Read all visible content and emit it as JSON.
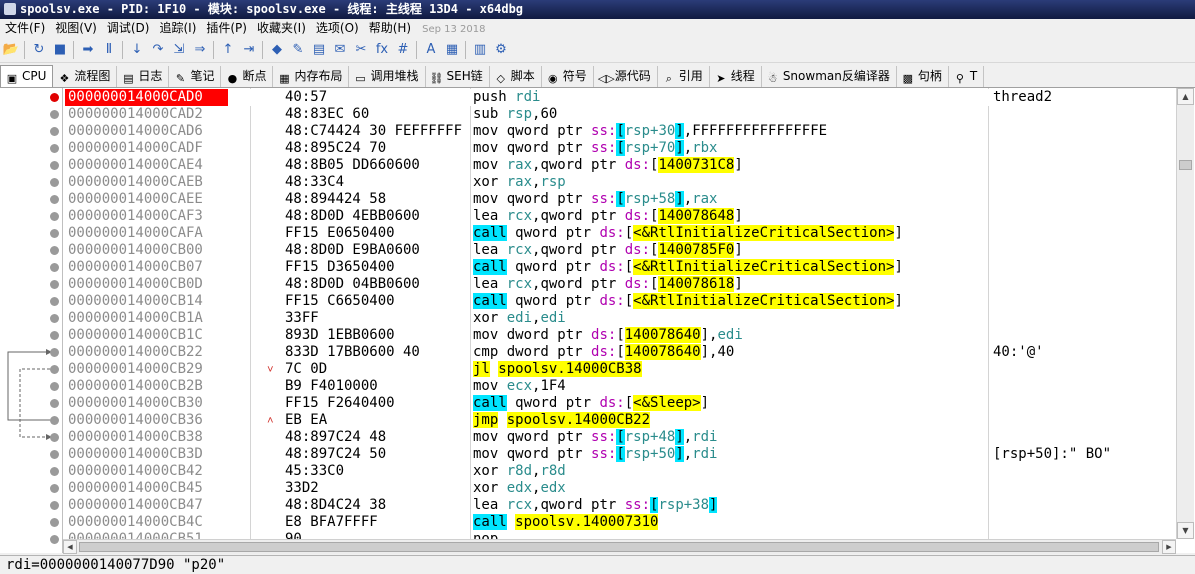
{
  "window": {
    "title": "spoolsv.exe - PID: 1F10 - 模块: spoolsv.exe - 线程: 主线程 13D4 - x64dbg"
  },
  "menu": {
    "items": [
      "文件(F)",
      "视图(V)",
      "调试(D)",
      "追踪(I)",
      "插件(P)",
      "收藏夹(I)",
      "选项(O)",
      "帮助(H)"
    ],
    "build_date": "Sep 13 2018"
  },
  "toolbar": {
    "icons": [
      "open-icon",
      "restart-icon",
      "stop-icon",
      "run-icon",
      "pause-icon",
      "step-into-icon",
      "step-over-icon",
      "trace-into-icon",
      "trace-over-icon",
      "execute-till-return-icon",
      "run-to-user-code-icon",
      "scylla-icon",
      "patch-icon",
      "comment-icon",
      "label-icon",
      "bookmark-icon",
      "function-icon",
      "hash-icon",
      "font-icon",
      "strings-icon",
      "calculator-icon",
      "settings-icon"
    ],
    "glyphs": [
      "📂",
      "↻",
      "■",
      "➡",
      "Ⅱ",
      "↓",
      "↷",
      "⇲",
      "⇒",
      "↑",
      "⇥",
      "◆",
      "✎",
      "▤",
      "✉",
      "✂",
      "fx",
      "#",
      "A",
      "▦",
      "▥",
      "⚙"
    ]
  },
  "tabs": [
    {
      "label": "CPU",
      "icon": "cpu-icon",
      "glyph": "▣",
      "active": true
    },
    {
      "label": "流程图",
      "icon": "graph-icon",
      "glyph": "❖"
    },
    {
      "label": "日志",
      "icon": "log-icon",
      "glyph": "▤"
    },
    {
      "label": "笔记",
      "icon": "notes-icon",
      "glyph": "✎"
    },
    {
      "label": "断点",
      "icon": "breakpoint-icon",
      "glyph": "●"
    },
    {
      "label": "内存布局",
      "icon": "memory-map-icon",
      "glyph": "▦"
    },
    {
      "label": "调用堆栈",
      "icon": "callstack-icon",
      "glyph": "▭"
    },
    {
      "label": "SEH链",
      "icon": "seh-icon",
      "glyph": "⛓"
    },
    {
      "label": "脚本",
      "icon": "script-icon",
      "glyph": "◇"
    },
    {
      "label": "符号",
      "icon": "symbols-icon",
      "glyph": "◉"
    },
    {
      "label": "源代码",
      "icon": "source-icon",
      "glyph": "◁▷"
    },
    {
      "label": "引用",
      "icon": "references-icon",
      "glyph": "⌕"
    },
    {
      "label": "线程",
      "icon": "threads-icon",
      "glyph": "➤"
    },
    {
      "label": "Snowman反编译器",
      "icon": "snowman-icon",
      "glyph": "☃"
    },
    {
      "label": "句柄",
      "icon": "handles-icon",
      "glyph": "▩"
    },
    {
      "label": "T",
      "icon": "trace-icon",
      "glyph": "⚲"
    }
  ],
  "disasm": {
    "rows": [
      {
        "addr": "000000014000CAD0",
        "bytes": "40:57",
        "asm": [
          [
            "m",
            "push "
          ],
          [
            "r",
            "rdi"
          ]
        ],
        "cmt": "thread2",
        "bp": true,
        "sel": true
      },
      {
        "addr": "000000014000CAD2",
        "bytes": "48:83EC 60",
        "asm": [
          [
            "m",
            "sub "
          ],
          [
            "r",
            "rsp"
          ],
          [
            "m",
            ",60"
          ]
        ]
      },
      {
        "addr": "000000014000CAD6",
        "bytes": "48:C74424 30 FEFFFFFF",
        "asm": [
          [
            "m",
            "mov qword ptr "
          ],
          [
            "s",
            "ss:"
          ],
          [
            "c",
            "["
          ],
          [
            "r",
            "rsp+30"
          ],
          [
            "c",
            "]"
          ],
          [
            "m",
            ",FFFFFFFFFFFFFFFE"
          ]
        ]
      },
      {
        "addr": "000000014000CADF",
        "bytes": "48:895C24 70",
        "asm": [
          [
            "m",
            "mov qword ptr "
          ],
          [
            "s",
            "ss:"
          ],
          [
            "c",
            "["
          ],
          [
            "r",
            "rsp+70"
          ],
          [
            "c",
            "]"
          ],
          [
            "m",
            ","
          ],
          [
            "r",
            "rbx"
          ]
        ]
      },
      {
        "addr": "000000014000CAE4",
        "bytes": "48:8B05 DD660600",
        "asm": [
          [
            "m",
            "mov "
          ],
          [
            "r",
            "rax"
          ],
          [
            "m",
            ",qword ptr "
          ],
          [
            "s",
            "ds:"
          ],
          [
            "m",
            "["
          ],
          [
            "h",
            "1400731C8"
          ],
          [
            "m",
            "]"
          ]
        ]
      },
      {
        "addr": "000000014000CAEB",
        "bytes": "48:33C4",
        "asm": [
          [
            "m",
            "xor "
          ],
          [
            "r",
            "rax"
          ],
          [
            "m",
            ","
          ],
          [
            "r",
            "rsp"
          ]
        ]
      },
      {
        "addr": "000000014000CAEE",
        "bytes": "48:894424 58",
        "asm": [
          [
            "m",
            "mov qword ptr "
          ],
          [
            "s",
            "ss:"
          ],
          [
            "c",
            "["
          ],
          [
            "r",
            "rsp+58"
          ],
          [
            "c",
            "]"
          ],
          [
            "m",
            ","
          ],
          [
            "r",
            "rax"
          ]
        ]
      },
      {
        "addr": "000000014000CAF3",
        "bytes": "48:8D0D 4EBB0600",
        "asm": [
          [
            "m",
            "lea "
          ],
          [
            "r",
            "rcx"
          ],
          [
            "m",
            ",qword ptr "
          ],
          [
            "s",
            "ds:"
          ],
          [
            "m",
            "["
          ],
          [
            "h",
            "140078648"
          ],
          [
            "m",
            "]"
          ]
        ]
      },
      {
        "addr": "000000014000CAFA",
        "bytes": "FF15 E0650400",
        "asm": [
          [
            "c",
            "call"
          ],
          [
            "m",
            " qword ptr "
          ],
          [
            "s",
            "ds:"
          ],
          [
            "m",
            "["
          ],
          [
            "h",
            "<&RtlInitializeCriticalSection>"
          ],
          [
            "m",
            "]"
          ]
        ]
      },
      {
        "addr": "000000014000CB00",
        "bytes": "48:8D0D E9BA0600",
        "asm": [
          [
            "m",
            "lea "
          ],
          [
            "r",
            "rcx"
          ],
          [
            "m",
            ",qword ptr "
          ],
          [
            "s",
            "ds:"
          ],
          [
            "m",
            "["
          ],
          [
            "h",
            "1400785F0"
          ],
          [
            "m",
            "]"
          ]
        ]
      },
      {
        "addr": "000000014000CB07",
        "bytes": "FF15 D3650400",
        "asm": [
          [
            "c",
            "call"
          ],
          [
            "m",
            " qword ptr "
          ],
          [
            "s",
            "ds:"
          ],
          [
            "m",
            "["
          ],
          [
            "h",
            "<&RtlInitializeCriticalSection>"
          ],
          [
            "m",
            "]"
          ]
        ]
      },
      {
        "addr": "000000014000CB0D",
        "bytes": "48:8D0D 04BB0600",
        "asm": [
          [
            "m",
            "lea "
          ],
          [
            "r",
            "rcx"
          ],
          [
            "m",
            ",qword ptr "
          ],
          [
            "s",
            "ds:"
          ],
          [
            "m",
            "["
          ],
          [
            "h",
            "140078618"
          ],
          [
            "m",
            "]"
          ]
        ]
      },
      {
        "addr": "000000014000CB14",
        "bytes": "FF15 C6650400",
        "asm": [
          [
            "c",
            "call"
          ],
          [
            "m",
            " qword ptr "
          ],
          [
            "s",
            "ds:"
          ],
          [
            "m",
            "["
          ],
          [
            "h",
            "<&RtlInitializeCriticalSection>"
          ],
          [
            "m",
            "]"
          ]
        ]
      },
      {
        "addr": "000000014000CB1A",
        "bytes": "33FF",
        "asm": [
          [
            "m",
            "xor "
          ],
          [
            "r",
            "edi"
          ],
          [
            "m",
            ","
          ],
          [
            "r",
            "edi"
          ]
        ]
      },
      {
        "addr": "000000014000CB1C",
        "bytes": "893D 1EBB0600",
        "asm": [
          [
            "m",
            "mov dword ptr "
          ],
          [
            "s",
            "ds:"
          ],
          [
            "m",
            "["
          ],
          [
            "h",
            "140078640"
          ],
          [
            "m",
            "],"
          ],
          [
            "r",
            "edi"
          ]
        ]
      },
      {
        "addr": "000000014000CB22",
        "bytes": "833D 17BB0600 40",
        "asm": [
          [
            "m",
            "cmp dword ptr "
          ],
          [
            "s",
            "ds:"
          ],
          [
            "m",
            "["
          ],
          [
            "h",
            "140078640"
          ],
          [
            "m",
            "],40"
          ]
        ],
        "cmt": "40:'@'"
      },
      {
        "addr": "000000014000CB29",
        "bytes": "7C 0D",
        "hint": "˅",
        "asm": [
          [
            "h",
            "jl"
          ],
          [
            "m",
            " "
          ],
          [
            "h",
            "spoolsv.14000CB38"
          ]
        ]
      },
      {
        "addr": "000000014000CB2B",
        "bytes": "B9 F4010000",
        "asm": [
          [
            "m",
            "mov "
          ],
          [
            "r",
            "ecx"
          ],
          [
            "m",
            ",1F4"
          ]
        ]
      },
      {
        "addr": "000000014000CB30",
        "bytes": "FF15 F2640400",
        "asm": [
          [
            "c",
            "call"
          ],
          [
            "m",
            " qword ptr "
          ],
          [
            "s",
            "ds:"
          ],
          [
            "m",
            "["
          ],
          [
            "h",
            "<&Sleep>"
          ],
          [
            "m",
            "]"
          ]
        ]
      },
      {
        "addr": "000000014000CB36",
        "bytes": "EB EA",
        "hint": "˄",
        "asm": [
          [
            "h",
            "jmp"
          ],
          [
            "m",
            " "
          ],
          [
            "h",
            "spoolsv.14000CB22"
          ]
        ]
      },
      {
        "addr": "000000014000CB38",
        "bytes": "48:897C24 48",
        "asm": [
          [
            "m",
            "mov qword ptr "
          ],
          [
            "s",
            "ss:"
          ],
          [
            "c",
            "["
          ],
          [
            "r",
            "rsp+48"
          ],
          [
            "c",
            "]"
          ],
          [
            "m",
            ","
          ],
          [
            "r",
            "rdi"
          ]
        ]
      },
      {
        "addr": "000000014000CB3D",
        "bytes": "48:897C24 50",
        "asm": [
          [
            "m",
            "mov qword ptr "
          ],
          [
            "s",
            "ss:"
          ],
          [
            "c",
            "["
          ],
          [
            "r",
            "rsp+50"
          ],
          [
            "c",
            "]"
          ],
          [
            "m",
            ","
          ],
          [
            "r",
            "rdi"
          ]
        ],
        "cmt": "[rsp+50]:\" BO\""
      },
      {
        "addr": "000000014000CB42",
        "bytes": "45:33C0",
        "asm": [
          [
            "m",
            "xor "
          ],
          [
            "r",
            "r8d"
          ],
          [
            "m",
            ","
          ],
          [
            "r",
            "r8d"
          ]
        ]
      },
      {
        "addr": "000000014000CB45",
        "bytes": "33D2",
        "asm": [
          [
            "m",
            "xor "
          ],
          [
            "r",
            "edx"
          ],
          [
            "m",
            ","
          ],
          [
            "r",
            "edx"
          ]
        ]
      },
      {
        "addr": "000000014000CB47",
        "bytes": "48:8D4C24 38",
        "asm": [
          [
            "m",
            "lea "
          ],
          [
            "r",
            "rcx"
          ],
          [
            "m",
            ",qword ptr "
          ],
          [
            "s",
            "ss:"
          ],
          [
            "c",
            "["
          ],
          [
            "r",
            "rsp+38"
          ],
          [
            "c",
            "]"
          ]
        ]
      },
      {
        "addr": "000000014000CB4C",
        "bytes": "E8 BFA7FFFF",
        "asm": [
          [
            "c",
            "call"
          ],
          [
            "m",
            " "
          ],
          [
            "h",
            "spoolsv.140007310"
          ]
        ]
      },
      {
        "addr": "000000014000CB51",
        "bytes": "90",
        "asm": [
          [
            "m",
            "nop"
          ]
        ]
      }
    ]
  },
  "status": {
    "text": "rdi=0000000140077D90 \"p20\""
  }
}
